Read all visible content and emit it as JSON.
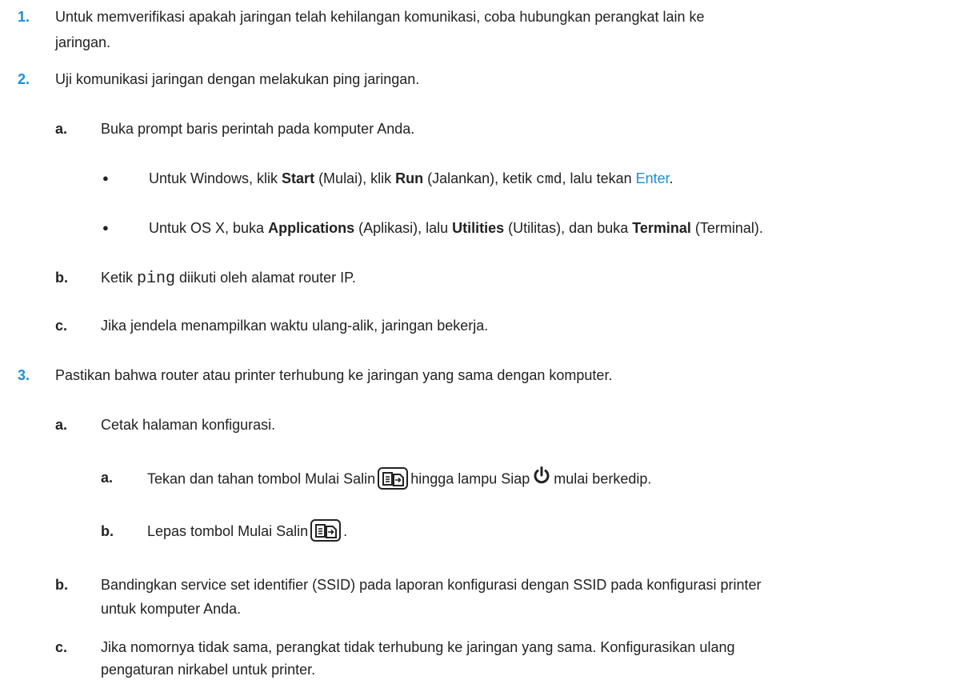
{
  "step1": {
    "num": "1.",
    "line1": "Untuk memverifikasi apakah jaringan telah kehilangan komunikasi, coba hubungkan perangkat lain ke",
    "line2": "jaringan."
  },
  "step2": {
    "num": "2.",
    "text": "Uji komunikasi jaringan dengan melakukan ping jaringan.",
    "a": {
      "num": "a.",
      "text": "Buka prompt baris perintah pada komputer Anda.",
      "bullet1": {
        "t1": "Untuk Windows, klik ",
        "start": "Start",
        "t2": " (Mulai), klik ",
        "run": "Run",
        "t3": " (Jalankan), ketik ",
        "cmd": "cmd",
        "t4": ", lalu tekan ",
        "enter": "Enter",
        "t5": "."
      },
      "bullet2": {
        "t1": "Untuk OS X, buka ",
        "applications": "Applications",
        "t2": " (Aplikasi), lalu ",
        "utilities": "Utilities",
        "t3": " (Utilitas), dan buka ",
        "terminal": "Terminal",
        "t4": " (Terminal)."
      }
    },
    "b": {
      "num": "b.",
      "t1": "Ketik ",
      "ping": "ping",
      "t2": " diikuti oleh alamat router IP."
    },
    "c": {
      "num": "c.",
      "text": "Jika jendela menampilkan waktu ulang-alik, jaringan bekerja."
    }
  },
  "step3": {
    "num": "3.",
    "text": "Pastikan bahwa router atau printer terhubung ke jaringan yang sama dengan komputer.",
    "a": {
      "num": "a.",
      "text": "Cetak halaman konfigurasi.",
      "sub_a": {
        "num": "a.",
        "t1": "Tekan dan tahan tombol Mulai Salin",
        "t2": "hingga lampu Siap",
        "t3": "mulai berkedip."
      },
      "sub_b": {
        "num": "b.",
        "t1": "Lepas tombol Mulai Salin",
        "t2": "."
      }
    },
    "b": {
      "num": "b.",
      "line1": "Bandingkan service set identifier (SSID) pada laporan konfigurasi dengan SSID pada konfigurasi printer",
      "line2": "untuk komputer Anda."
    },
    "c": {
      "num": "c.",
      "line1": "Jika nomornya tidak sama, perangkat tidak terhubung ke jaringan yang sama. Konfigurasikan ulang",
      "line2": "pengaturan nirkabel untuk printer."
    }
  },
  "icons": {
    "copy": "copy-start-icon",
    "power": "power-ready-icon",
    "bullet": "bullet-icon"
  },
  "colors": {
    "accent": "#1a8fd6",
    "text": "#222222"
  }
}
